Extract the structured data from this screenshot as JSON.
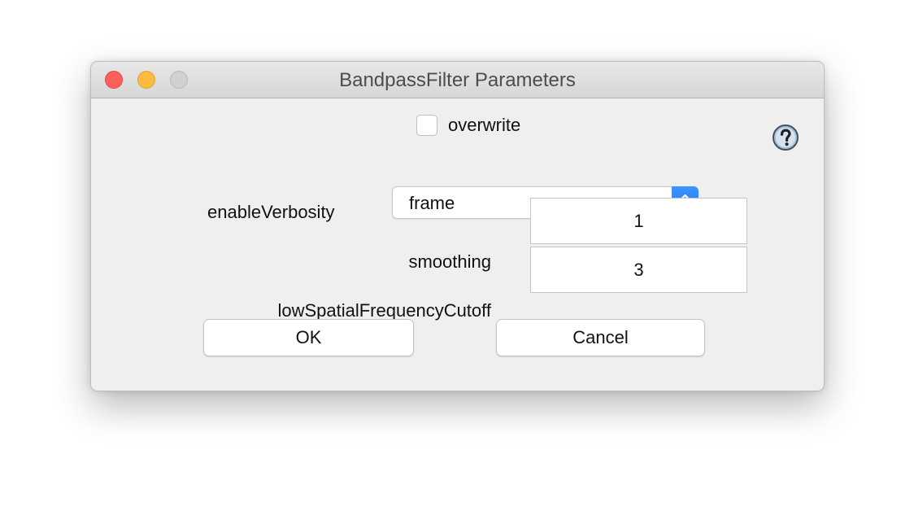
{
  "window": {
    "title": "BandpassFilter Parameters"
  },
  "form": {
    "overwrite": {
      "label": "overwrite",
      "checked": false
    },
    "enableVerbosity": {
      "label": "enableVerbosity",
      "value": "frame"
    },
    "smoothing": {
      "label": "smoothing",
      "value": "1"
    },
    "lowSpatialFrequencyCutoff": {
      "label": "lowSpatialFrequencyCutoff",
      "value": "3"
    }
  },
  "buttons": {
    "ok": "OK",
    "cancel": "Cancel"
  },
  "icons": {
    "help": "help-icon",
    "close": "close-icon",
    "minimize": "minimize-icon",
    "zoom": "zoom-icon",
    "stepper": "chevron-up-down-icon"
  },
  "colors": {
    "close": "#fc605b",
    "minimize": "#fdbc40",
    "zoom_disabled": "#d0d0d0",
    "select_accent": "#1a6ff0"
  }
}
